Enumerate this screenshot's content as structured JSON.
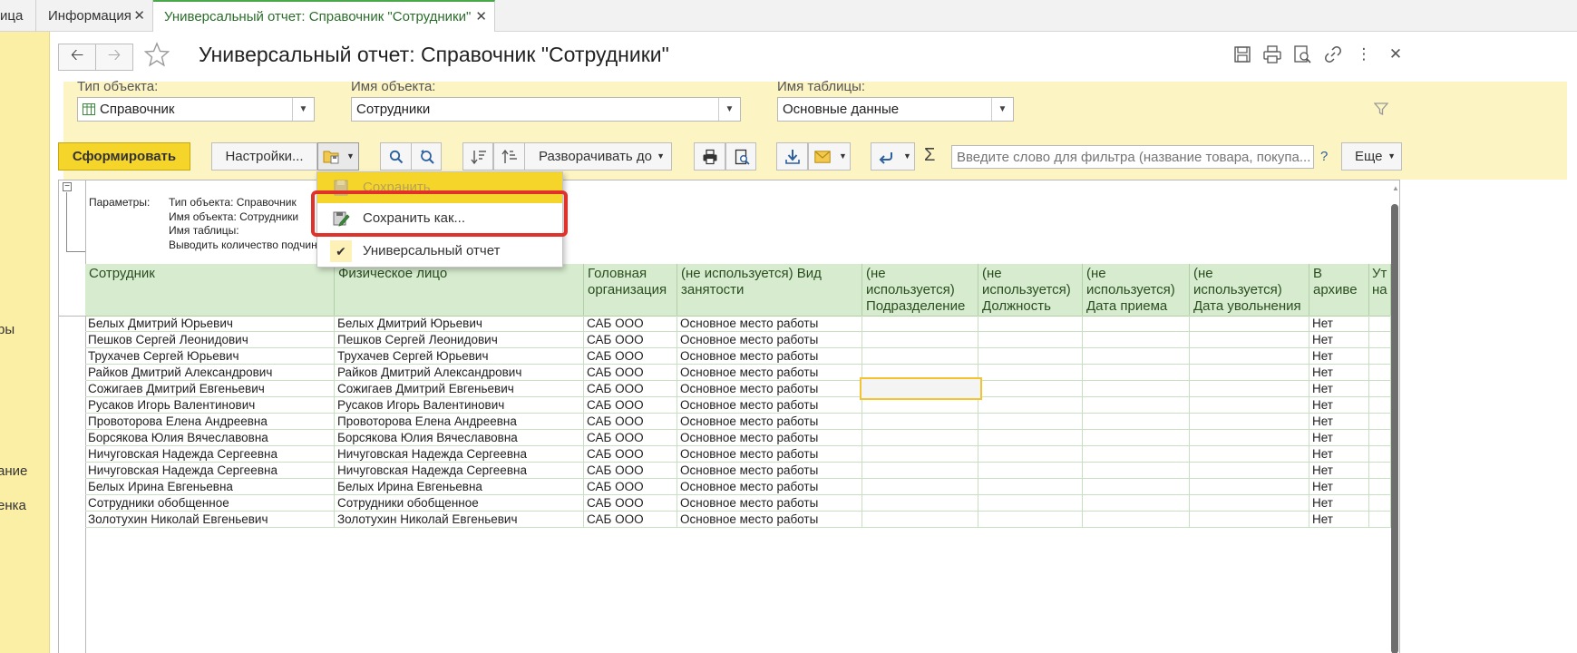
{
  "tabs": [
    {
      "label": "ица"
    },
    {
      "label": "Информация"
    },
    {
      "label": "Универсальный отчет: Справочник \"Сотрудники\""
    }
  ],
  "sidebar": {
    "items": [
      {
        "label": "ры"
      },
      {
        "label": "ание"
      },
      {
        "label": "енка"
      }
    ]
  },
  "form": {
    "title": "Универсальный отчет: Справочник \"Сотрудники\""
  },
  "params": {
    "object_type_label": "Тип объекта:",
    "object_type_value": "Справочник",
    "object_name_label": "Имя объекта:",
    "object_name_value": "Сотрудники",
    "table_name_label": "Имя таблицы:",
    "table_name_value": "Основные данные"
  },
  "toolbar": {
    "generate_label": "Сформировать",
    "settings_label": "Настройки...",
    "expand_label": "Разворачивать до",
    "filter_placeholder": "Введите слово для фильтра (название товара, покупа...",
    "help_label": "?",
    "more_label": "Еще"
  },
  "menu": {
    "items": [
      {
        "label": "Сохранить",
        "disabled": true
      },
      {
        "label": "Сохранить как..."
      },
      {
        "label": "Универсальный отчет",
        "checked": true
      }
    ]
  },
  "report_params": {
    "title": "Параметры:",
    "lines": [
      "Тип объекта: Справочник",
      "Имя объекта: Сотрудники",
      "Имя таблицы:",
      "Выводить количество подчине"
    ]
  },
  "table": {
    "columns": [
      "Сотрудник",
      "Физическое лицо",
      "Головная организация",
      "(не используется) Вид занятости",
      "(не используется) Подразделение",
      "(не используется) Должность",
      "(не используется) Дата приема",
      "(не используется) Дата увольнения",
      "В архиве",
      "Ут на"
    ],
    "rows": [
      [
        "Белых Дмитрий Юрьевич",
        "Белых Дмитрий Юрьевич",
        "САБ ООО",
        "Основное место работы",
        "",
        "",
        "",
        "",
        "Нет"
      ],
      [
        "Пешков Сергей Леонидович",
        "Пешков Сергей Леонидович",
        "САБ ООО",
        "Основное место работы",
        "",
        "",
        "",
        "",
        "Нет"
      ],
      [
        "Трухачев Сергей Юрьевич",
        "Трухачев Сергей Юрьевич",
        "САБ ООО",
        "Основное место работы",
        "",
        "",
        "",
        "",
        "Нет"
      ],
      [
        "Райков Дмитрий Александрович",
        "Райков Дмитрий Александрович",
        "САБ ООО",
        "Основное место работы",
        "",
        "",
        "",
        "",
        "Нет"
      ],
      [
        "Сожигаев Дмитрий Евгеньевич",
        "Сожигаев Дмитрий Евгеньевич",
        "САБ ООО",
        "Основное место работы",
        "",
        "",
        "",
        "",
        "Нет"
      ],
      [
        "Русаков Игорь Валентинович",
        "Русаков Игорь Валентинович",
        "САБ ООО",
        "Основное место работы",
        "",
        "",
        "",
        "",
        "Нет"
      ],
      [
        "Провоторова Елена Андреевна",
        "Провоторова Елена Андреевна",
        "САБ ООО",
        "Основное место работы",
        "",
        "",
        "",
        "",
        "Нет"
      ],
      [
        "Борсякова Юлия Вячеславовна",
        "Борсякова Юлия Вячеславовна",
        "САБ ООО",
        "Основное место работы",
        "",
        "",
        "",
        "",
        "Нет"
      ],
      [
        "Ничуговская Надежда Сергеевна",
        "Ничуговская Надежда Сергеевна",
        "САБ ООО",
        "Основное место работы",
        "",
        "",
        "",
        "",
        "Нет"
      ],
      [
        "Ничуговская Надежда Сергеевна",
        "Ничуговская Надежда Сергеевна",
        "САБ ООО",
        "Основное место работы",
        "",
        "",
        "",
        "",
        "Нет"
      ],
      [
        "Белых Ирина Евгеньевна",
        "Белых Ирина Евгеньевна",
        "САБ ООО",
        "Основное место работы",
        "",
        "",
        "",
        "",
        "Нет"
      ],
      [
        "Сотрудники обобщенное",
        "Сотрудники обобщенное",
        "САБ ООО",
        "Основное место работы",
        "",
        "",
        "",
        "",
        "Нет"
      ],
      [
        "Золотухин Николай Евгеньевич",
        "Золотухин Николай Евгеньевич",
        "САБ ООО",
        "Основное место работы",
        "",
        "",
        "",
        "",
        "Нет"
      ]
    ]
  },
  "colors": {
    "sidebar_bg": "#fbeea5",
    "params_bg": "#fdf4c4",
    "generate_btn": "#f6d52b",
    "table_header_bg": "#d7eccf",
    "highlight_red": "#e0312b",
    "selected_cell_border": "#f4c430"
  }
}
